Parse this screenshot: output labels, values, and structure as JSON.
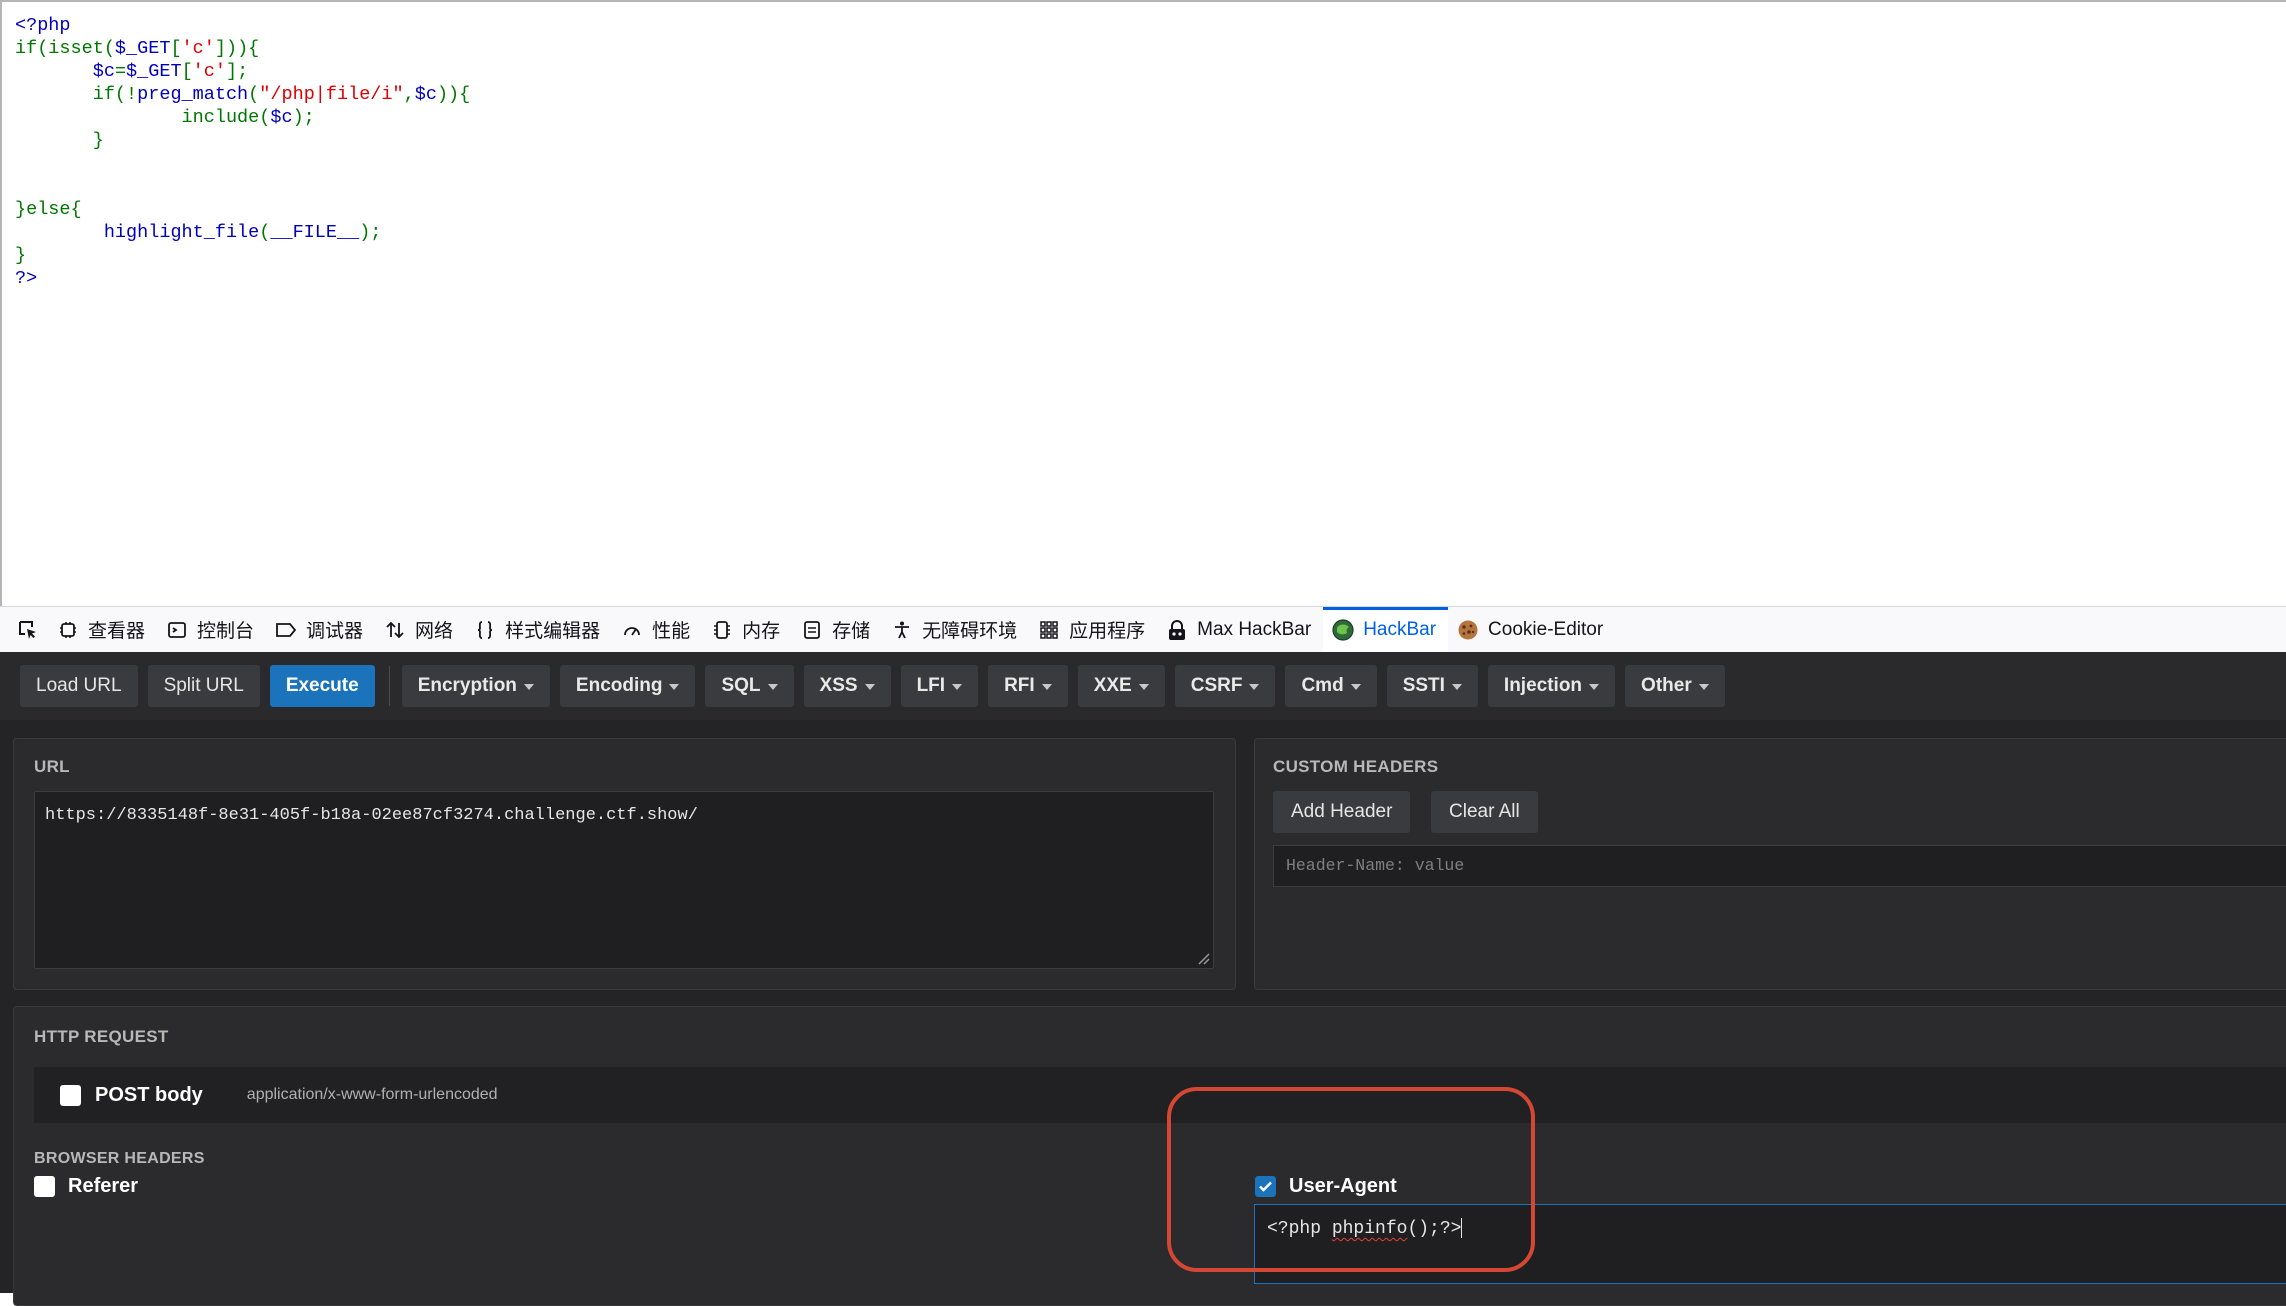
{
  "source_code": {
    "lines": [
      [
        {
          "t": "<?php",
          "c": "f"
        }
      ],
      [
        {
          "t": "if(isset(",
          "c": "k"
        },
        {
          "t": "$_GET",
          "c": "f"
        },
        {
          "t": "[",
          "c": "k"
        },
        {
          "t": "'c'",
          "c": "s"
        },
        {
          "t": "])){",
          "c": "k"
        }
      ],
      [
        {
          "t": "       ",
          "c": "f"
        },
        {
          "t": "$c",
          "c": "f"
        },
        {
          "t": "=",
          "c": "k"
        },
        {
          "t": "$_GET",
          "c": "f"
        },
        {
          "t": "[",
          "c": "k"
        },
        {
          "t": "'c'",
          "c": "s"
        },
        {
          "t": "];",
          "c": "k"
        }
      ],
      [
        {
          "t": "       ",
          "c": "f"
        },
        {
          "t": "if(!",
          "c": "k"
        },
        {
          "t": "preg_match",
          "c": "f"
        },
        {
          "t": "(",
          "c": "k"
        },
        {
          "t": "\"/php|file/i\"",
          "c": "s"
        },
        {
          "t": ",",
          "c": "k"
        },
        {
          "t": "$c",
          "c": "f"
        },
        {
          "t": ")){",
          "c": "k"
        }
      ],
      [
        {
          "t": "               ",
          "c": "f"
        },
        {
          "t": "include(",
          "c": "k"
        },
        {
          "t": "$c",
          "c": "f"
        },
        {
          "t": ");",
          "c": "k"
        }
      ],
      [
        {
          "t": "       }",
          "c": "k"
        }
      ],
      [
        {
          "t": "",
          "c": "f"
        }
      ],
      [
        {
          "t": "",
          "c": "f"
        }
      ],
      [
        {
          "t": "}else{",
          "c": "k"
        }
      ],
      [
        {
          "t": "        ",
          "c": "f"
        },
        {
          "t": "highlight_file",
          "c": "f"
        },
        {
          "t": "(",
          "c": "k"
        },
        {
          "t": "__FILE__",
          "c": "f"
        },
        {
          "t": ");",
          "c": "k"
        }
      ],
      [
        {
          "t": "}",
          "c": "k"
        }
      ],
      [
        {
          "t": "?>",
          "c": "f"
        }
      ]
    ]
  },
  "devtools": {
    "tabs": [
      {
        "label": "查看器",
        "icon": "inspector-icon",
        "name": "tab-inspector"
      },
      {
        "label": "控制台",
        "icon": "console-icon",
        "name": "tab-console"
      },
      {
        "label": "调试器",
        "icon": "debugger-icon",
        "name": "tab-debugger"
      },
      {
        "label": "网络",
        "icon": "network-icon",
        "name": "tab-network"
      },
      {
        "label": "样式编辑器",
        "icon": "style-editor-icon",
        "name": "tab-style-editor"
      },
      {
        "label": "性能",
        "icon": "performance-icon",
        "name": "tab-performance"
      },
      {
        "label": "内存",
        "icon": "memory-icon",
        "name": "tab-memory"
      },
      {
        "label": "存储",
        "icon": "storage-icon",
        "name": "tab-storage"
      },
      {
        "label": "无障碍环境",
        "icon": "accessibility-icon",
        "name": "tab-accessibility"
      },
      {
        "label": "应用程序",
        "icon": "application-icon",
        "name": "tab-application"
      },
      {
        "label": "Max HackBar",
        "icon": "max-hackbar-icon",
        "name": "tab-max-hackbar"
      },
      {
        "label": "HackBar",
        "icon": "hackbar-icon",
        "name": "tab-hackbar",
        "active": true
      },
      {
        "label": "Cookie-Editor",
        "icon": "cookie-icon",
        "name": "tab-cookie-editor"
      }
    ]
  },
  "toolbar": {
    "load_url": "Load URL",
    "split_url": "Split URL",
    "execute": "Execute",
    "menus": [
      "Encryption",
      "Encoding",
      "SQL",
      "XSS",
      "LFI",
      "RFI",
      "XXE",
      "CSRF",
      "Cmd",
      "SSTI",
      "Injection",
      "Other"
    ]
  },
  "url_panel": {
    "title": "URL",
    "value": "https://8335148f-8e31-405f-b18a-02ee87cf3274.challenge.ctf.show/"
  },
  "headers_panel": {
    "title": "CUSTOM HEADERS",
    "add_header": "Add Header",
    "clear_all": "Clear All",
    "placeholder": "Header-Name: value"
  },
  "http_request": {
    "title": "HTTP REQUEST",
    "post_body_label": "POST body",
    "post_body_checked": false,
    "content_type": "application/x-www-form-urlencoded",
    "browser_headers_title": "BROWSER HEADERS",
    "referer_label": "Referer",
    "referer_checked": false,
    "user_agent_label": "User-Agent",
    "user_agent_checked": true,
    "user_agent_value_prefix": "<?php ",
    "user_agent_value_word": "phpinfo",
    "user_agent_value_suffix": "();?>"
  },
  "colors": {
    "accent": "#1a73bb",
    "devtools_active": "#0061e0",
    "annotation": "#d34733"
  }
}
